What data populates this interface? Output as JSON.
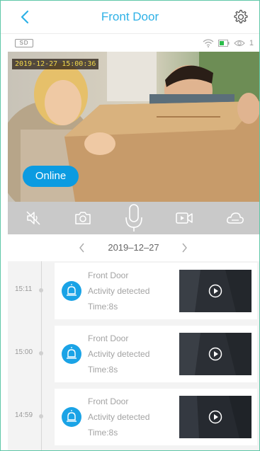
{
  "header": {
    "title": "Front Door"
  },
  "status": {
    "sd_label": "SD",
    "viewer_count": "1",
    "battery_color": "#2bbd4a"
  },
  "video": {
    "timestamp": "2019-12-27  15:00:36",
    "online_label": "Online"
  },
  "date_bar": {
    "date": "2019–12–27"
  },
  "events": [
    {
      "time": "15:11",
      "camera": "Front Door",
      "message": "Activity detected",
      "duration": "Time:8s"
    },
    {
      "time": "15:00",
      "camera": "Front Door",
      "message": "Activity detected",
      "duration": "Time:8s"
    },
    {
      "time": "14:59",
      "camera": "Front Door",
      "message": "Activity detected",
      "duration": "Time:8s"
    }
  ],
  "colors": {
    "accent": "#2eb1e6",
    "online": "#0b9be1",
    "frame_border": "#5fc7a8"
  }
}
